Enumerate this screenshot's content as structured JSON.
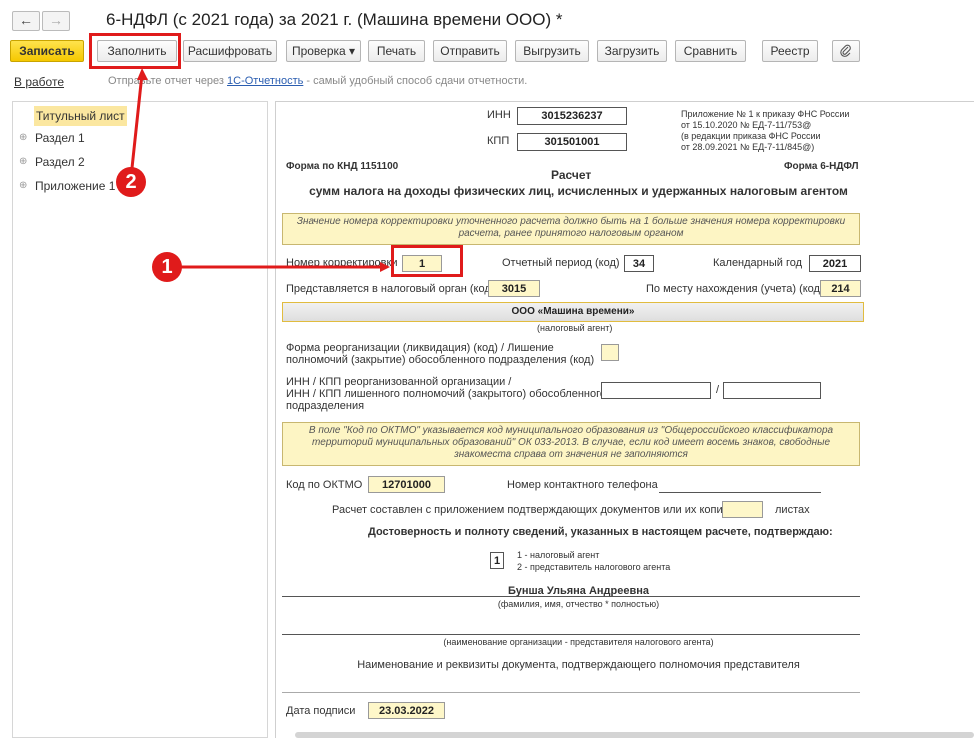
{
  "window": {
    "title": "6-НДФЛ (с 2021 года) за 2021 г. (Машина времени ООО) *",
    "back_icon": "arrow-left-icon",
    "forward_icon": "arrow-right-icon"
  },
  "toolbar": {
    "save": "Записать",
    "fill": "Заполнить",
    "decode": "Расшифровать",
    "check": "Проверка ▾",
    "print": "Печать",
    "send": "Отправить",
    "export": "Выгрузить",
    "import": "Загрузить",
    "compare": "Сравнить",
    "registry": "Реестр",
    "attach_icon": "paperclip-icon"
  },
  "status": {
    "state": "В работе",
    "hint_prefix": "Отправьте отчет через ",
    "hint_link": "1С-Отчетность",
    "hint_suffix": " - самый удобный способ сдачи отчетности."
  },
  "tree": {
    "items": [
      {
        "label": "Титульный лист"
      },
      {
        "label": "Раздел 1"
      },
      {
        "label": "Раздел 2"
      },
      {
        "label": "Приложение 1"
      }
    ]
  },
  "doc": {
    "inn_label": "ИНН",
    "inn": "3015236237",
    "kpp_label": "КПП",
    "kpp": "301501001",
    "appendix_1": "Приложение № 1 к приказу ФНС России",
    "appendix_2": "от 15.10.2020 № ЕД-7-11/753@",
    "appendix_3": "(в редакции приказа ФНС России",
    "appendix_4": "от 28.09.2021 № ЕД-7-11/845@)",
    "knd": "Форма по КНД 1151100",
    "form_code": "Форма 6-НДФЛ",
    "title_1": "Расчет",
    "title_2": "сумм налога на доходы физических лиц, исчисленных и удержанных налоговым агентом",
    "note_1a": "Значение номера корректировки уточненного расчета должно быть на 1 больше значения номера корректировки",
    "note_1b": "расчета, ранее принятого налоговым органом",
    "corr_label": "Номер корректировки",
    "corr": "1",
    "period_label": "Отчетный период (код)",
    "period": "34",
    "year_label": "Календарный год",
    "year": "2021",
    "tax_org_label": "Представляется в налоговый орган (код)",
    "tax_org": "3015",
    "location_label": "По месту нахождения (учета) (код)",
    "location": "214",
    "agent_name": "ООО «Машина времени»",
    "agent_caption": "(налоговый агент)",
    "reorg_1": "Форма реорганизации (ликвидация) (код) / Лишение",
    "reorg_2": "полномочий (закрытие) обособленного подразделения (код)",
    "reorg_inn_1": "ИНН / КПП реорганизованной организации /",
    "reorg_inn_2": "ИНН / КПП лишенного полномочий (закрытого) обособленного",
    "reorg_inn_3": "подразделения",
    "slash": "/",
    "note_2a": "В поле \"Код по ОКТМО\" указывается код муниципального образования из \"Общероссийского классификатора",
    "note_2b": "территорий муниципальных образований\" ОК 033-2013. В случае, если код имеет восемь знаков, свободные",
    "note_2c": "знакоместа справа от значения не заполняются",
    "oktmo_label": "Код по ОКТМО",
    "oktmo": "12701000",
    "phone_label": "Номер контактного телефона",
    "sheets_label": "Расчет составлен с приложением подтверждающих документов или их копий на",
    "sheets_suffix": "листах",
    "confirm": "Достоверность и полноту сведений, указанных в настоящем расчете, подтверждаю:",
    "signer_code": "1",
    "signer_opt_1": "1 - налоговый агент",
    "signer_opt_2": "2 - представитель налогового агента",
    "signer_name": "Бунша Ульяна Андреевна",
    "signer_caption": "(фамилия, имя, отчество * полностью)",
    "org_caption": "(наименование организации - представителя налогового агента)",
    "doc_caption": "Наименование и реквизиты документа, подтверждающего полномочия представителя",
    "date_label": "Дата подписи",
    "date": "23.03.2022"
  },
  "annotations": {
    "marker_1": "1",
    "marker_2": "2",
    "accent": "#e01b1b"
  }
}
